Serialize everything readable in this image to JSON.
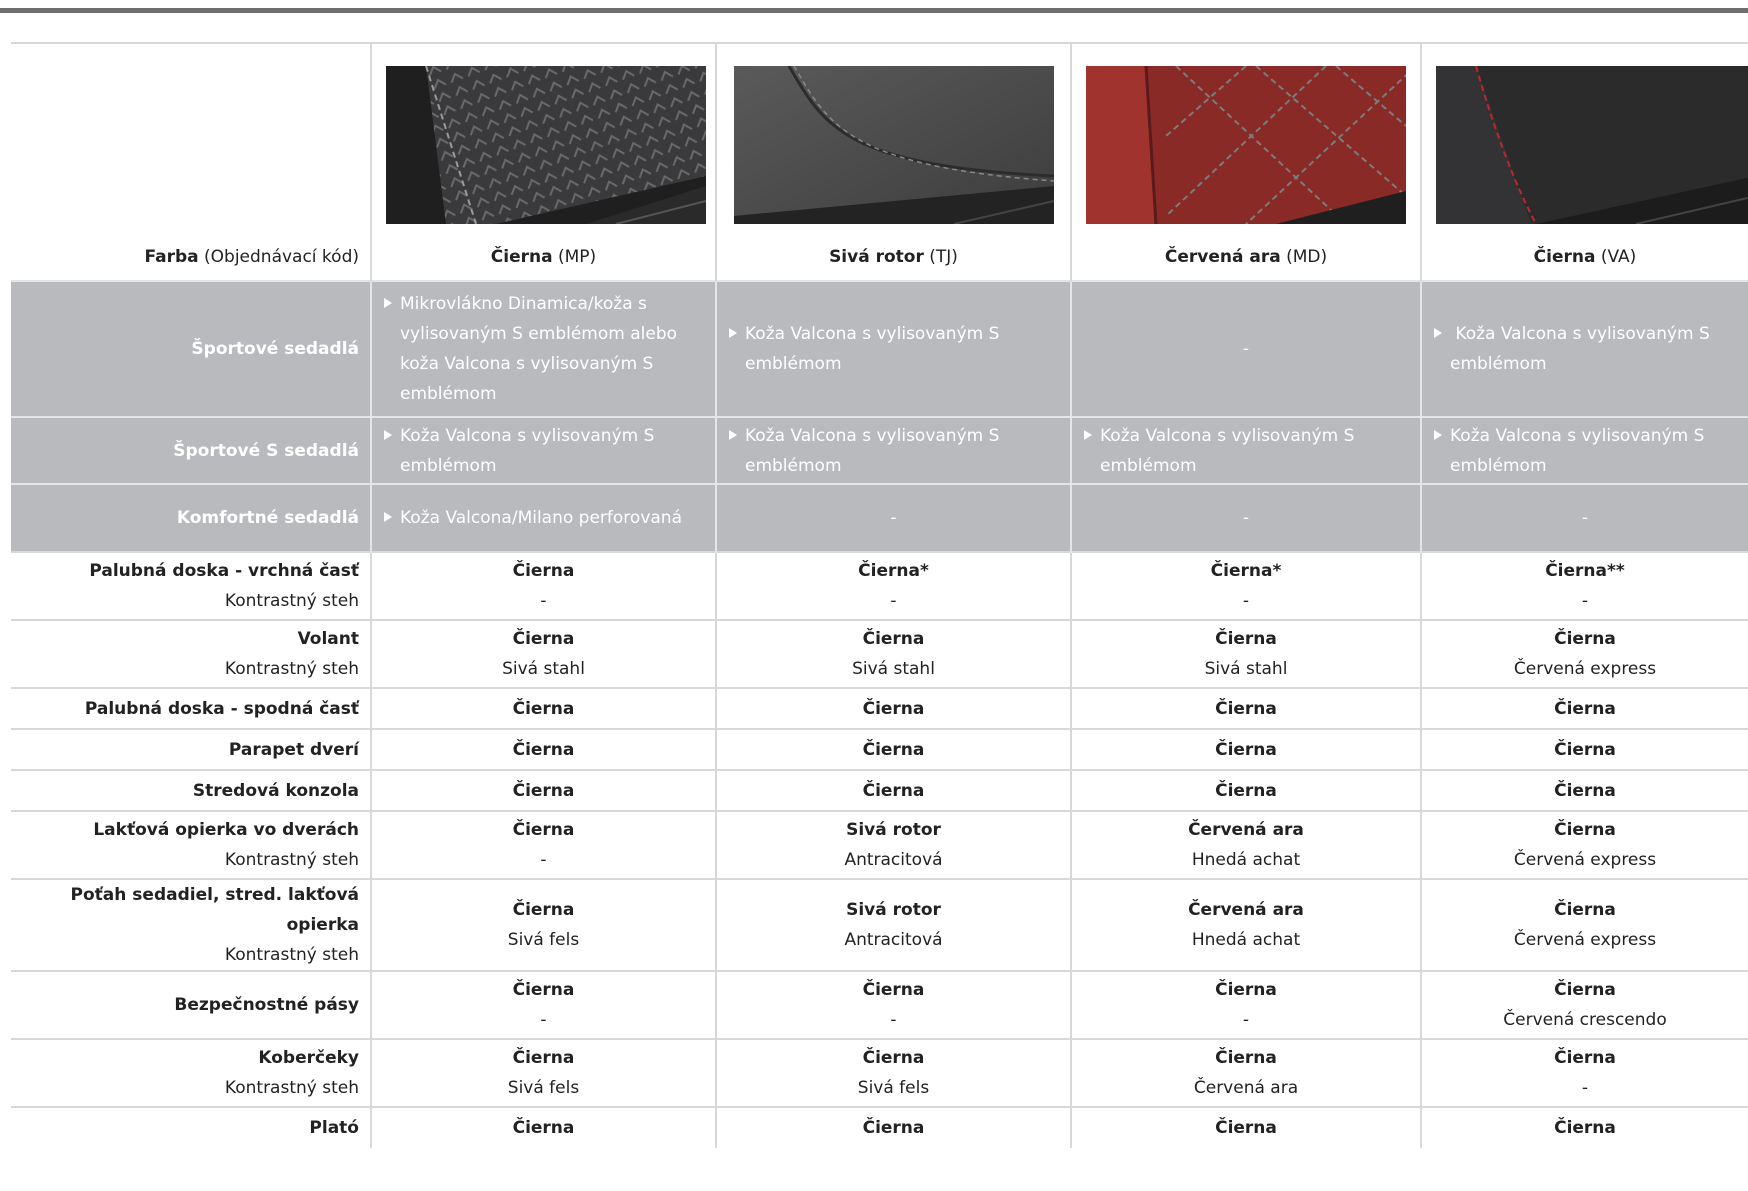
{
  "header": {
    "farba_label": "Farba",
    "farba_code_label": "(Objednávací kód)",
    "colors": [
      {
        "name": "Čierna",
        "code": "(MP)"
      },
      {
        "name": "Sivá rotor",
        "code": "(TJ)"
      },
      {
        "name": "Červená ara",
        "code": "(MD)"
      },
      {
        "name": "Čierna",
        "code": "(VA)"
      }
    ]
  },
  "grey_rows": [
    {
      "label": "Športové sedadlá",
      "cells": [
        "Mikrovlákno Dinamica/koža  s vylisovaným S emblémom alebo koža Valcona s vylisovaným S emblémom",
        "Koža Valcona s vylisovaným S emblémom",
        "-",
        " Koža Valcona s vylisovaným S emblémom"
      ]
    },
    {
      "label": "Športové S sedadlá",
      "cells": [
        "Koža Valcona s vylisovaným S emblémom",
        "Koža Valcona s vylisovaným S emblémom",
        "Koža Valcona s vylisovaným S emblémom",
        "Koža Valcona s vylisovaným S emblémom"
      ]
    },
    {
      "label": "Komfortné sedadlá",
      "cells": [
        "Koža Valcona/Milano perforovaná",
        "-",
        "-",
        "-"
      ]
    }
  ],
  "rows": [
    {
      "label": "Palubná doska - vrchná časť",
      "sub_label": "Kontrastný steh",
      "cells": [
        [
          "Čierna",
          "-"
        ],
        [
          "Čierna*",
          "-"
        ],
        [
          "Čierna*",
          "-"
        ],
        [
          "Čierna**",
          "-"
        ]
      ]
    },
    {
      "label": "Volant",
      "sub_label": "Kontrastný steh",
      "cells": [
        [
          "Čierna",
          "Sivá stahl"
        ],
        [
          "Čierna",
          "Sivá stahl"
        ],
        [
          "Čierna",
          "Sivá stahl"
        ],
        [
          "Čierna",
          "Červená express"
        ]
      ]
    },
    {
      "label": "Palubná doska - spodná časť",
      "sub_label": "",
      "cells": [
        [
          "Čierna",
          ""
        ],
        [
          "Čierna",
          ""
        ],
        [
          "Čierna",
          ""
        ],
        [
          "Čierna",
          ""
        ]
      ]
    },
    {
      "label": "Parapet dverí",
      "sub_label": "",
      "cells": [
        [
          "Čierna",
          ""
        ],
        [
          "Čierna",
          ""
        ],
        [
          "Čierna",
          ""
        ],
        [
          "Čierna",
          ""
        ]
      ]
    },
    {
      "label": "Stredová konzola",
      "sub_label": "",
      "cells": [
        [
          "Čierna",
          ""
        ],
        [
          "Čierna",
          ""
        ],
        [
          "Čierna",
          ""
        ],
        [
          "Čierna",
          ""
        ]
      ]
    },
    {
      "label": "Lakťová opierka vo dverách",
      "sub_label": "Kontrastný steh",
      "cells": [
        [
          "Čierna",
          "-"
        ],
        [
          "Sivá rotor",
          "Antracitová"
        ],
        [
          "Červená ara",
          "Hnedá achat"
        ],
        [
          "Čierna",
          "Červená express"
        ]
      ]
    },
    {
      "label": "Poťah sedadiel, stred. lakťová opierka",
      "sub_label": "Kontrastný steh",
      "cells": [
        [
          "Čierna",
          "Sivá fels"
        ],
        [
          "Sivá rotor",
          "Antracitová"
        ],
        [
          "Červená ara",
          "Hnedá achat"
        ],
        [
          "Čierna",
          "Červená express"
        ]
      ]
    },
    {
      "label": "Bezpečnostné pásy",
      "sub_label": "",
      "cells": [
        [
          "Čierna",
          "-"
        ],
        [
          "Čierna",
          "-"
        ],
        [
          "Čierna",
          "-"
        ],
        [
          "Čierna",
          "Červená crescendo"
        ]
      ]
    },
    {
      "label": "Koberčeky",
      "sub_label": "Kontrastný steh",
      "cells": [
        [
          "Čierna",
          "Sivá fels"
        ],
        [
          "Čierna",
          "Sivá fels"
        ],
        [
          "Čierna",
          "Červená ara"
        ],
        [
          "Čierna",
          "-"
        ]
      ]
    },
    {
      "label": "Plató",
      "sub_label": "",
      "cells": [
        [
          "Čierna",
          ""
        ],
        [
          "Čierna",
          ""
        ],
        [
          "Čierna",
          ""
        ],
        [
          "Čierna",
          ""
        ]
      ]
    }
  ]
}
